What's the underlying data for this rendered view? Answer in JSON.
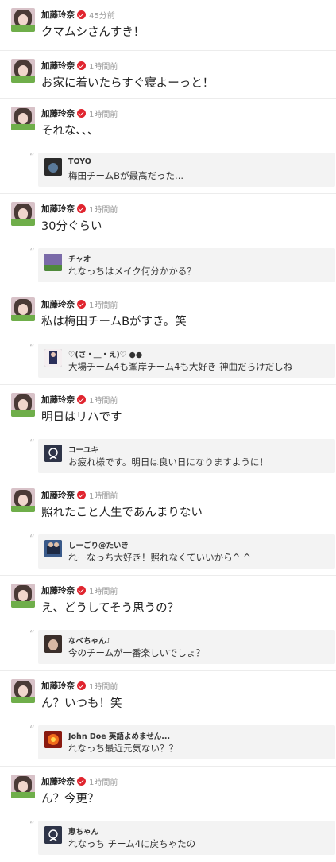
{
  "posts": [
    {
      "author": "加藤玲奈",
      "time": "45分前",
      "text": "クマムシさんすき！",
      "reply": null
    },
    {
      "author": "加藤玲奈",
      "time": "1時間前",
      "text": "お家に着いたらすぐ寝よーっと！",
      "reply": null
    },
    {
      "author": "加藤玲奈",
      "time": "1時間前",
      "text": "それな、、、",
      "reply": {
        "name": "TOYO",
        "text": "梅田チームBが最高だった..."
      }
    },
    {
      "author": "加藤玲奈",
      "time": "1時間前",
      "text": "30分ぐらい",
      "reply": {
        "name": "チャオ",
        "text": "れなっちはメイク何分かかる？"
      }
    },
    {
      "author": "加藤玲奈",
      "time": "1時間前",
      "text": "私は梅田チームBがすき。笑",
      "reply": {
        "name": "♡(さ・＿・え)♡ ●●",
        "text": "大場チーム4も峯岸チーム4も大好き  神曲だらけだしね"
      }
    },
    {
      "author": "加藤玲奈",
      "time": "1時間前",
      "text": "明日はリハです",
      "reply": {
        "name": "コーユキ",
        "text": "お疲れ様です。明日は良い日になりますように！"
      }
    },
    {
      "author": "加藤玲奈",
      "time": "1時間前",
      "text": "照れたこと人生であんまりない",
      "reply": {
        "name": "しーごり@たいき",
        "text": "れーなっち大好き！照れなくていいから^ ^"
      }
    },
    {
      "author": "加藤玲奈",
      "time": "1時間前",
      "text": "え、どうしてそう思うの？",
      "reply": {
        "name": "なべちゃん♪",
        "text": "今のチームが一番楽しいでしょ？"
      }
    },
    {
      "author": "加藤玲奈",
      "time": "1時間前",
      "text": "ん？いつも！笑",
      "reply": {
        "name": "John Doe 英語よめません...",
        "text": "れなっち最近元気ない？？"
      }
    },
    {
      "author": "加藤玲奈",
      "time": "1時間前",
      "text": "ん？今更？",
      "reply": {
        "name": "恵ちゃん",
        "text": "れなっち チーム4に戻ちゃたの"
      }
    }
  ],
  "icons": {
    "verified": "verified-check-icon",
    "quote": "quote-mark-icon"
  },
  "colors": {
    "verified": "#e0242e",
    "reply_bg": "#f3f3f3",
    "time": "#999999"
  }
}
